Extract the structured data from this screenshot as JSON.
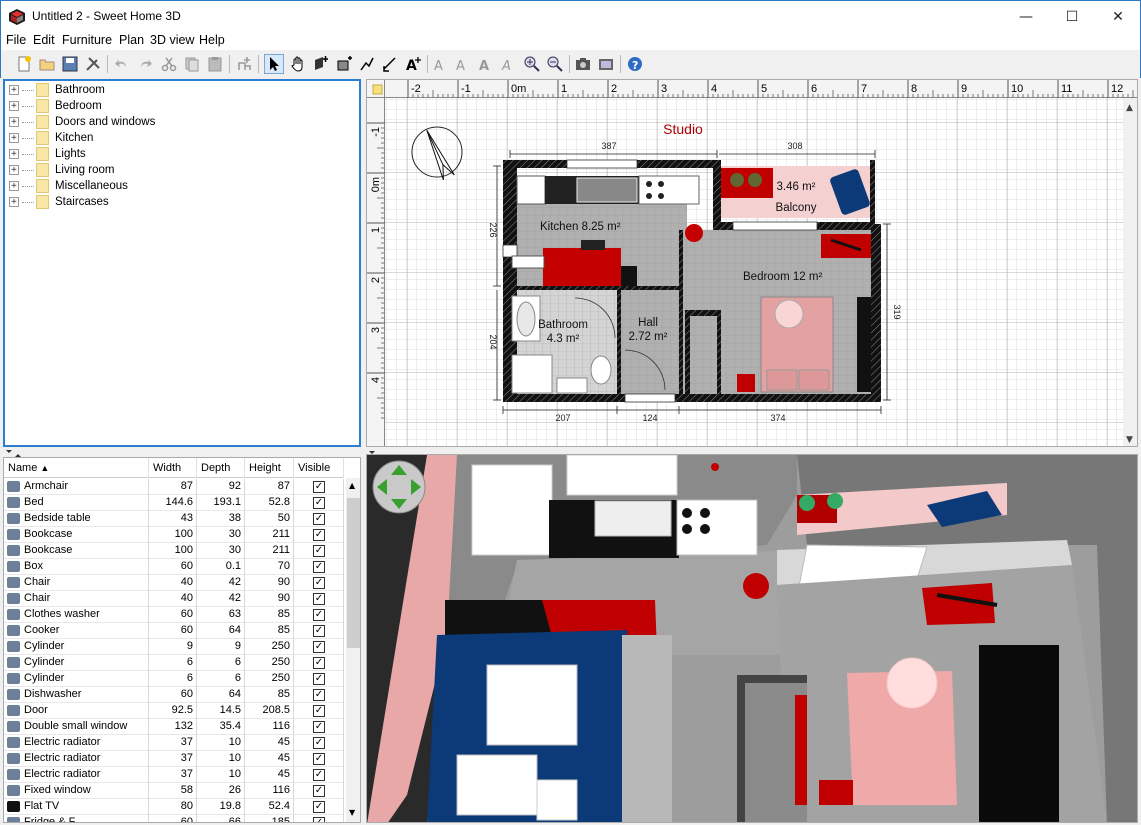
{
  "window": {
    "title": "Untitled 2 - Sweet Home 3D",
    "minimize": "—",
    "maximize": "☐",
    "close": "✕"
  },
  "menu": [
    "File",
    "Edit",
    "Furniture",
    "Plan",
    "3D view",
    "Help"
  ],
  "toolbar_icons": [
    "new-icon",
    "open-icon",
    "save-icon",
    "preferences-icon",
    "undo-icon",
    "redo-icon",
    "cut-icon",
    "copy-icon",
    "paste-icon",
    "add-furniture-icon",
    "select-icon",
    "pan-icon",
    "create-walls-icon",
    "create-rooms-icon",
    "create-polylines-icon",
    "create-dimensions-icon",
    "add-text-icon",
    "text-style-1-icon",
    "text-style-2-icon",
    "text-style-3-icon",
    "text-style-4-icon",
    "zoom-in-icon",
    "zoom-out-icon",
    "create-photo-icon",
    "create-video-icon",
    "help-icon"
  ],
  "catalog": [
    "Bathroom",
    "Bedroom",
    "Doors and windows",
    "Kitchen",
    "Lights",
    "Living room",
    "Miscellaneous",
    "Staircases"
  ],
  "furniture_table": {
    "columns": [
      "Name",
      "Width",
      "Depth",
      "Height",
      "Visible"
    ],
    "sort_indicator": "▲",
    "rows": [
      {
        "name": "Armchair",
        "width": "87",
        "depth": "92",
        "height": "87",
        "icon": "armchair-icon"
      },
      {
        "name": "Bed",
        "width": "144.6",
        "depth": "193.1",
        "height": "52.8",
        "icon": "bed-icon"
      },
      {
        "name": "Bedside table",
        "width": "43",
        "depth": "38",
        "height": "50",
        "icon": "table-icon"
      },
      {
        "name": "Bookcase",
        "width": "100",
        "depth": "30",
        "height": "211",
        "icon": "bookcase-icon"
      },
      {
        "name": "Bookcase",
        "width": "100",
        "depth": "30",
        "height": "211",
        "icon": "bookcase-icon"
      },
      {
        "name": "Box",
        "width": "60",
        "depth": "0.1",
        "height": "70",
        "icon": "box-icon"
      },
      {
        "name": "Chair",
        "width": "40",
        "depth": "42",
        "height": "90",
        "icon": "chair-icon"
      },
      {
        "name": "Chair",
        "width": "40",
        "depth": "42",
        "height": "90",
        "icon": "chair-icon"
      },
      {
        "name": "Clothes washer",
        "width": "60",
        "depth": "63",
        "height": "85",
        "icon": "washer-icon"
      },
      {
        "name": "Cooker",
        "width": "60",
        "depth": "64",
        "height": "85",
        "icon": "cooker-icon"
      },
      {
        "name": "Cylinder",
        "width": "9",
        "depth": "9",
        "height": "250",
        "icon": "cylinder-icon"
      },
      {
        "name": "Cylinder",
        "width": "6",
        "depth": "6",
        "height": "250",
        "icon": "cylinder-icon"
      },
      {
        "name": "Cylinder",
        "width": "6",
        "depth": "6",
        "height": "250",
        "icon": "cylinder-icon"
      },
      {
        "name": "Dishwasher",
        "width": "60",
        "depth": "64",
        "height": "85",
        "icon": "dishwasher-icon"
      },
      {
        "name": "Door",
        "width": "92.5",
        "depth": "14.5",
        "height": "208.5",
        "icon": "door-icon"
      },
      {
        "name": "Double small window",
        "width": "132",
        "depth": "35.4",
        "height": "116",
        "icon": "window-icon"
      },
      {
        "name": "Electric radiator",
        "width": "37",
        "depth": "10",
        "height": "45",
        "icon": "radiator-icon"
      },
      {
        "name": "Electric radiator",
        "width": "37",
        "depth": "10",
        "height": "45",
        "icon": "radiator-icon"
      },
      {
        "name": "Electric radiator",
        "width": "37",
        "depth": "10",
        "height": "45",
        "icon": "radiator-icon"
      },
      {
        "name": "Fixed window",
        "width": "58",
        "depth": "26",
        "height": "116",
        "icon": "window-icon"
      },
      {
        "name": "Flat TV",
        "width": "80",
        "depth": "19.8",
        "height": "52.4",
        "icon": "tv-icon"
      },
      {
        "name": "Fridge & F",
        "width": "60",
        "depth": "66",
        "height": "185",
        "icon": "fridge-icon"
      }
    ]
  },
  "plan": {
    "title": "Studio",
    "ruler_x": [
      "-2",
      "-1",
      "0m",
      "1",
      "2",
      "3",
      "4",
      "5",
      "6",
      "7",
      "8",
      "9",
      "10",
      "11",
      "12"
    ],
    "ruler_y": [
      "-1",
      "0m",
      "1",
      "2",
      "3",
      "4"
    ],
    "rooms": [
      {
        "name": "Kitchen",
        "area": "8.25 m²"
      },
      {
        "name": "Balcony",
        "area": "3.46 m²"
      },
      {
        "name": "Bedroom",
        "area": "12 m²"
      },
      {
        "name": "Bathroom",
        "area": "4.3 m²"
      },
      {
        "name": "Hall",
        "area": "2.72 m²"
      }
    ],
    "dimensions": {
      "top_left": "387",
      "top_right": "308",
      "left_upper": "226",
      "left_lower": "204",
      "right": "319",
      "bottom_1": "207",
      "bottom_2": "124",
      "bottom_3": "374"
    }
  },
  "colors": {
    "accent": "#2d7dd2",
    "wall": "#1a1a1a",
    "floor": "#b3b3b3",
    "red": "#c00000",
    "pink": "#e4a1a1",
    "blue_tile": "#0c3a78"
  }
}
